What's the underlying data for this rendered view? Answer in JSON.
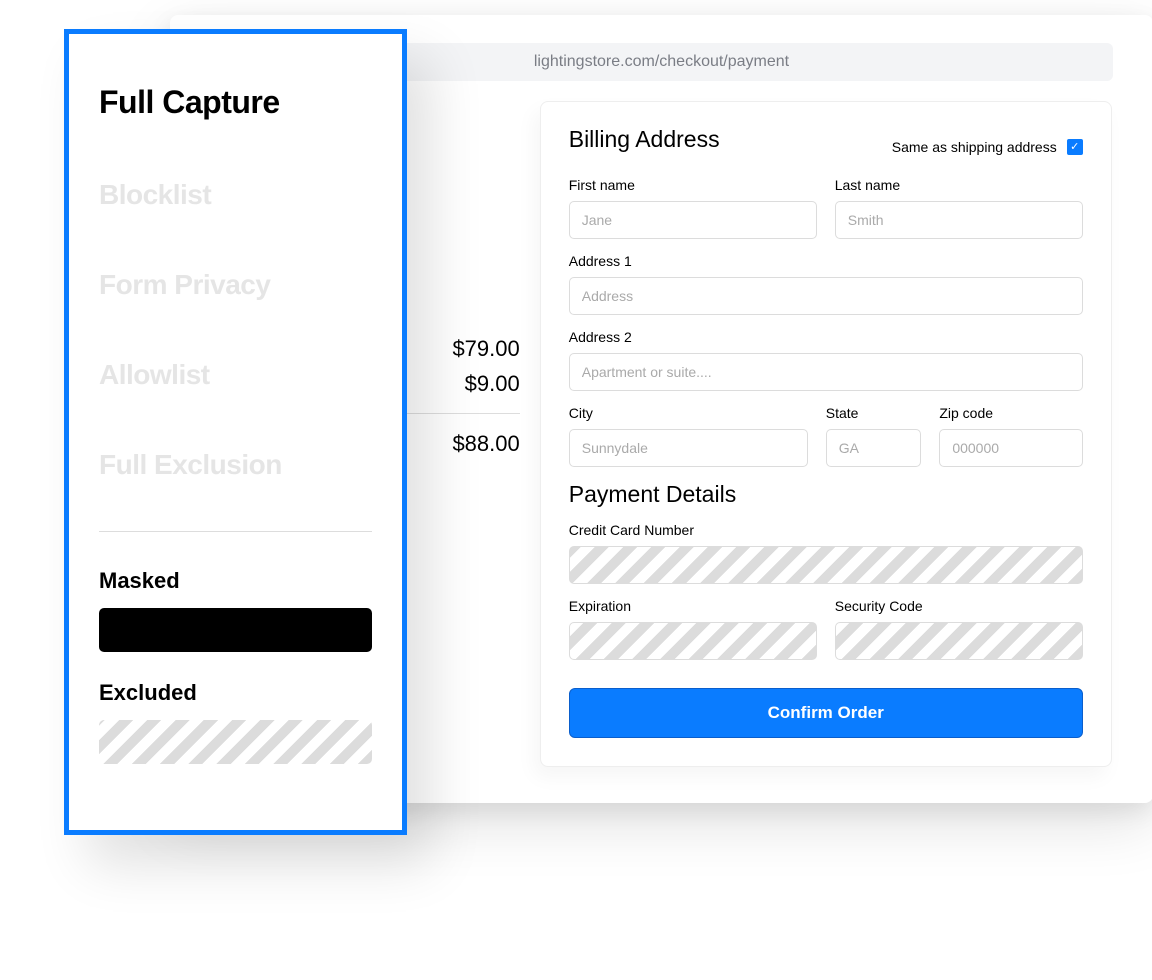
{
  "browser": {
    "url": "lightingstore.com/checkout/payment"
  },
  "summary": {
    "line1": "$79.00",
    "line2": "$9.00",
    "total": "$88.00"
  },
  "billing": {
    "title": "Billing Address",
    "same_as_label": "Same as shipping address",
    "same_as_checked": true,
    "first_name_label": "First name",
    "first_name_placeholder": "Jane",
    "last_name_label": "Last name",
    "last_name_placeholder": "Smith",
    "address1_label": "Address 1",
    "address1_placeholder": "Address",
    "address2_label": "Address 2",
    "address2_placeholder": "Apartment or suite....",
    "city_label": "City",
    "city_placeholder": "Sunnydale",
    "state_label": "State",
    "state_placeholder": "GA",
    "zip_label": "Zip code",
    "zip_placeholder": "000000"
  },
  "payment": {
    "title": "Payment Details",
    "cc_label": "Credit Card Number",
    "exp_label": "Expiration",
    "cvv_label": "Security Code",
    "confirm_label": "Confirm Order"
  },
  "sidebar": {
    "title": "Full Capture",
    "items": [
      "Blocklist",
      "Form Privacy",
      "Allowlist",
      "Full Exclusion"
    ],
    "masked_label": "Masked",
    "excluded_label": "Excluded"
  }
}
